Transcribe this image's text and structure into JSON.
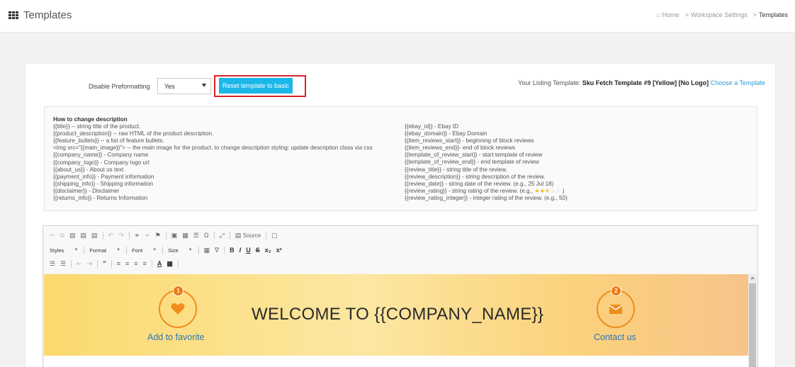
{
  "header": {
    "title": "Templates",
    "breadcrumb": [
      "Home",
      "Workspace Settings",
      "Templates"
    ]
  },
  "settings": {
    "preformat_label": "Disable Preformatting",
    "preformat_value": "Yes",
    "reset_label": "Reset template to basic",
    "listing_prefix": "Your Listing Template:",
    "listing_name": "Sku Fetch Template #9 [Yellow] [No Logo]",
    "choose_label": "Choose a Template"
  },
  "help": {
    "title": "How to change description",
    "left": [
      "{{title}} -- string title of the product.",
      "{{product_description}} -- raw HTML of the product description.",
      "{{feature_bullets}} -- a list of feature bullets.",
      "<img src=\"{{main_image}}\"> -- the main image for the product. to change description styling: update description class via css",
      "{{company_name}} - Company name",
      "{{company_logo}} - Company logo url",
      "{{about_us}} - About us text",
      "{{payment_info}} - Payment information",
      "{{shipping_info}} - Shipping information",
      "{{disclaimer}} - Disclaimer",
      "{{returns_info}} - Returns Information"
    ],
    "right": [
      "{{ebay_id}} - Ebay ID",
      "{{ebay_domain}} - Ebay Domain",
      "{{item_reviews_start}} - beginning of block reviews",
      "{{item_reviews_end}}- end of block reviews",
      "{{template_of_review_start}} - start template of review",
      "{{template_of_review_end}} - end template of review",
      "{{review_title}} - string title of the review.",
      "{{review_description}} - string description of the review.",
      "{{review_date}} - string date of the review. (e.g., 25 Jul 18)",
      "{{review_rating}} - string rating of the review. (e.g.,",
      "{{review_rating_integer}} - integer rating of the review. (e.g., 50)"
    ],
    "rating_suffix": ")",
    "rating_stars": 2.5
  },
  "editor": {
    "source_label": "Source",
    "styles_label": "Styles",
    "format_label": "Format",
    "font_label": "Font",
    "size_label": "Size"
  },
  "preview": {
    "title": "WELCOME TO {{COMPANY_NAME}}",
    "fav_badge": "1",
    "fav_label": "Add to favorite",
    "contact_badge": "2",
    "contact_label": "Contact us"
  },
  "colors": {
    "accent": "#1cb7e9",
    "highlight": "#d9232b",
    "orange": "#f08c1b",
    "link": "#2f75b8"
  }
}
